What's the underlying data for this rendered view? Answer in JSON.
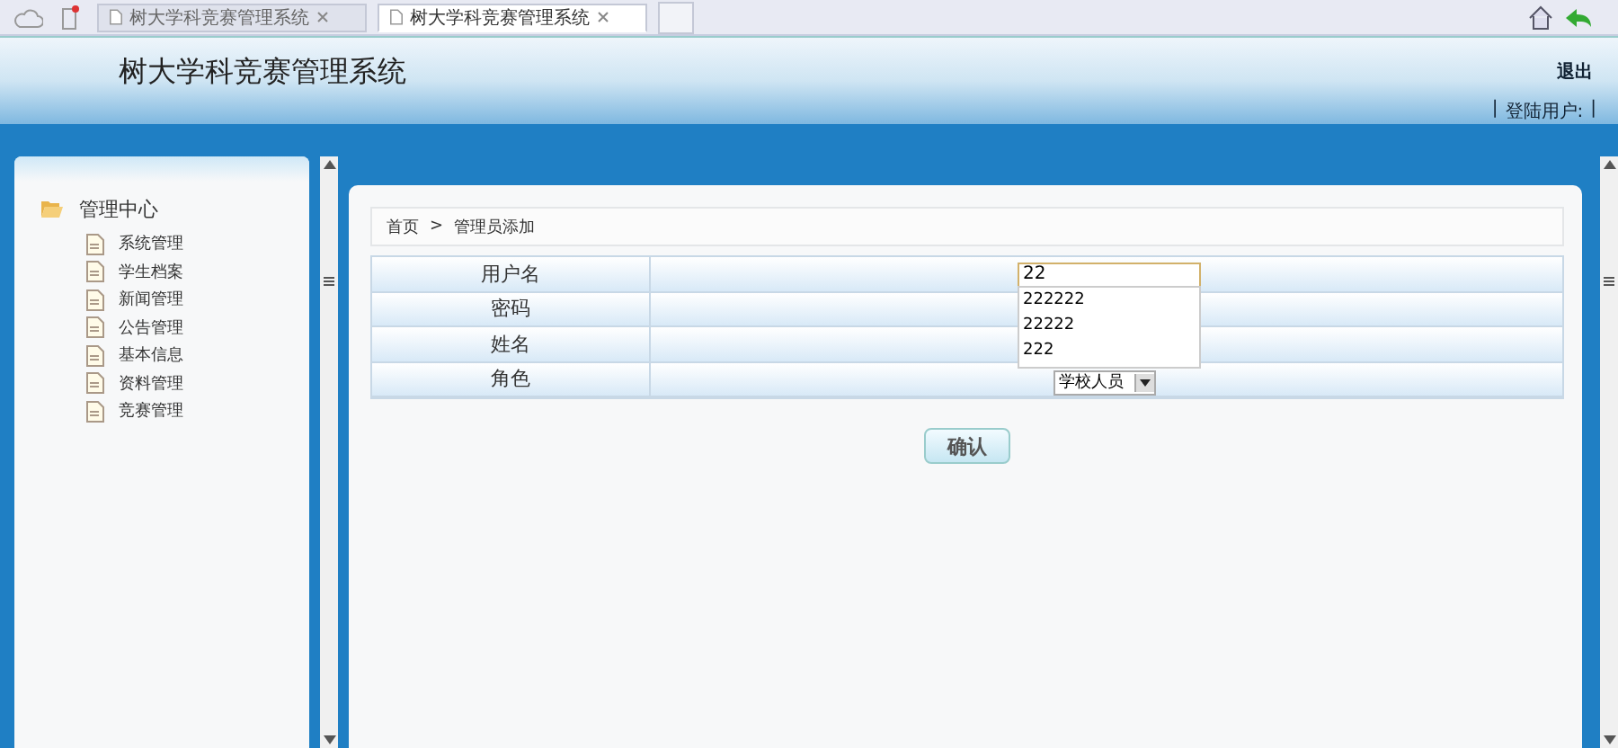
{
  "browser_tabs": [
    {
      "label": "树大学科竞赛管理系统",
      "selected": false
    },
    {
      "label": "树大学科竞赛管理系统",
      "selected": true
    }
  ],
  "header": {
    "title": "树大学科竞赛管理系统",
    "logout": "退出",
    "separator": "|",
    "login_user": "登陆用户:"
  },
  "sidebar": {
    "root": {
      "label": "管理中心",
      "expanded": true,
      "children": [
        {
          "label": "系统管理"
        },
        {
          "label": "学生档案"
        },
        {
          "label": "新闻管理"
        },
        {
          "label": "公告管理"
        },
        {
          "label": "基本信息"
        },
        {
          "label": "资料管理"
        },
        {
          "label": "竞赛管理"
        }
      ]
    }
  },
  "breadcrumb": [
    "首页",
    ">",
    "管理员添加"
  ],
  "form": {
    "rows": [
      {
        "label": "用户名",
        "kind": "text",
        "value": "22"
      },
      {
        "label": "密码",
        "kind": "empty"
      },
      {
        "label": "姓名",
        "kind": "empty"
      },
      {
        "label": "角色",
        "kind": "select",
        "value": "学校人员"
      }
    ],
    "suggestions": [
      "222222",
      "22222",
      "222"
    ],
    "submit": "确认"
  }
}
